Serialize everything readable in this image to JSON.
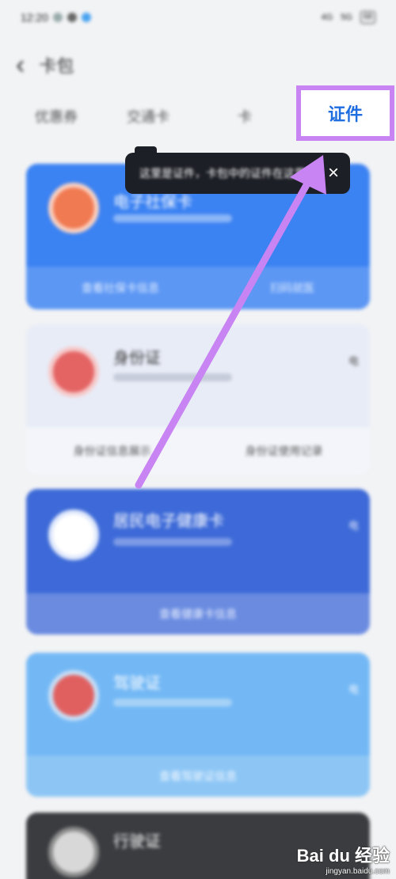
{
  "status_bar": {
    "time": "12:20",
    "signal": "4G",
    "signal2": "5G",
    "battery": "68"
  },
  "header": {
    "title": "卡包"
  },
  "tabs": {
    "items": [
      {
        "label": "优惠券"
      },
      {
        "label": "交通卡"
      },
      {
        "label": "卡"
      }
    ],
    "active_label": "证件"
  },
  "tooltip": {
    "text": "这里是证件，卡包中的证件在这里"
  },
  "cards": [
    {
      "name": "电子社保卡",
      "actions": [
        "查看社保卡信息",
        "扫码就医"
      ],
      "color": "#3b82f2"
    },
    {
      "name": "身份证",
      "tag": "电",
      "actions": [
        "身份证信息展示",
        "身份证使用记录"
      ],
      "color": "#e8ecf7"
    },
    {
      "name": "居民电子健康卡",
      "tag": "电",
      "actions": [
        "查看健康卡信息"
      ],
      "color": "#3d6ad8"
    },
    {
      "name": "驾驶证",
      "tag": "电",
      "actions": [
        "查看驾驶证信息"
      ],
      "color": "#73b8f5"
    },
    {
      "name": "行驶证",
      "color": "#3b3c40"
    }
  ],
  "watermark": {
    "brand": "Bai du 经验",
    "url": "jingyan.baidu.com"
  }
}
